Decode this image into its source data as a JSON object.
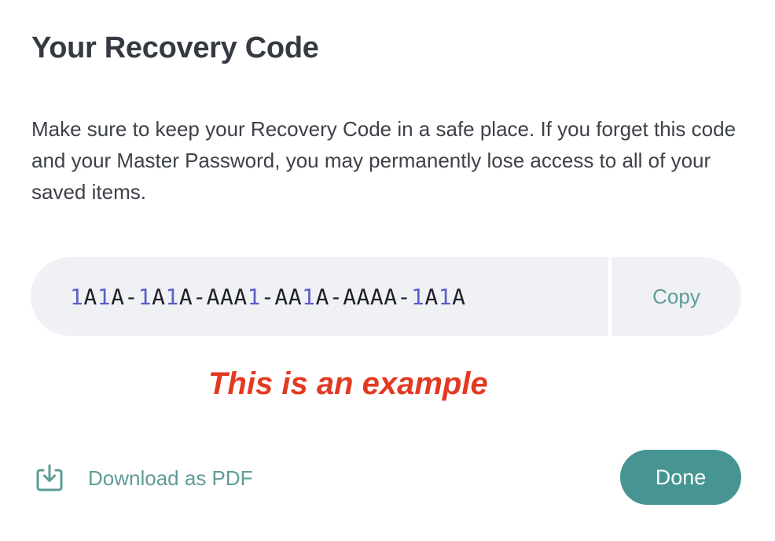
{
  "dialog": {
    "title": "Your Recovery Code",
    "description": "Make sure to keep your Recovery Code in a safe place. If you forget this code and your Master Password, you may permanently lose access to all of your saved items."
  },
  "recovery_code": {
    "value": "1A1A-1A1A-AAA1-AA1A-AAAA-1A1A",
    "copy_label": "Copy"
  },
  "annotation": {
    "text": "This is an example"
  },
  "footer": {
    "download_label": "Download as PDF",
    "download_icon": "download-tray-icon",
    "done_label": "Done"
  },
  "colors": {
    "title": "#353a42",
    "body_text": "#3d4148",
    "code_background": "#f0f1f5",
    "code_digit": "#5b5fc7",
    "code_letter": "#1e2126",
    "link_teal": "#5e9c97",
    "primary_button": "#469592",
    "annotation_red": "#e23a22"
  }
}
